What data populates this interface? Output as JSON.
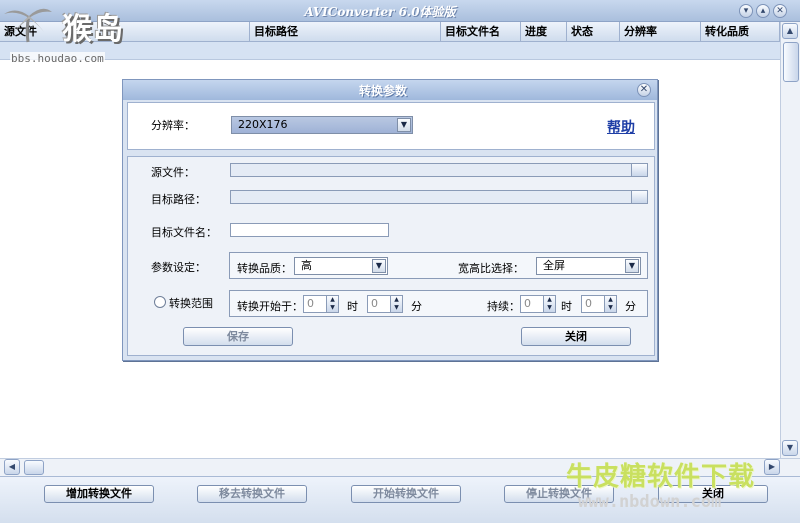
{
  "window": {
    "title": "AVIConverter 6.0体验版",
    "min_glyph": "▾",
    "max_glyph": "▴",
    "close_glyph": "✕"
  },
  "columns": [
    "源文件",
    "目标路径",
    "目标文件名",
    "进度",
    "状态",
    "分辨率",
    "转化品质"
  ],
  "watermarks": {
    "top_left_text": "猴岛",
    "top_left_url": "bbs.houdao.com",
    "bottom_right_text": "牛皮糖软件下载",
    "bottom_right_url": "www.nbdown.com"
  },
  "dialog": {
    "title": "转换参数",
    "close_glyph": "✕",
    "resolution_label": "分辨率：",
    "resolution_value": "220X176",
    "help_link": "帮助",
    "source_label": "源文件：",
    "target_path_label": "目标路径：",
    "target_filename_label": "目标文件名：",
    "param_label": "参数设定：",
    "quality_label": "转换品质：",
    "quality_value": "高",
    "aspect_label": "宽高比选择：",
    "aspect_value": "全屏",
    "range_label": "转换范围",
    "start_label": "转换开始于：",
    "start_hour": "0",
    "hour_unit": "时",
    "start_min": "0",
    "min_unit": "分",
    "duration_label": "持续：",
    "dur_hour": "0",
    "dur_min": "0",
    "save_label": "保存",
    "close_label": "关闭",
    "dropdown_arrow": "▼",
    "spin_up": "▲",
    "spin_down": "▼"
  },
  "scroll": {
    "up": "▲",
    "down": "▼",
    "left": "◀",
    "right": "▶"
  },
  "toolbar": {
    "add": "增加转换文件",
    "remove": "移去转换文件",
    "start": "开始转换文件",
    "stop": "停止转换文件",
    "close": "关闭"
  }
}
